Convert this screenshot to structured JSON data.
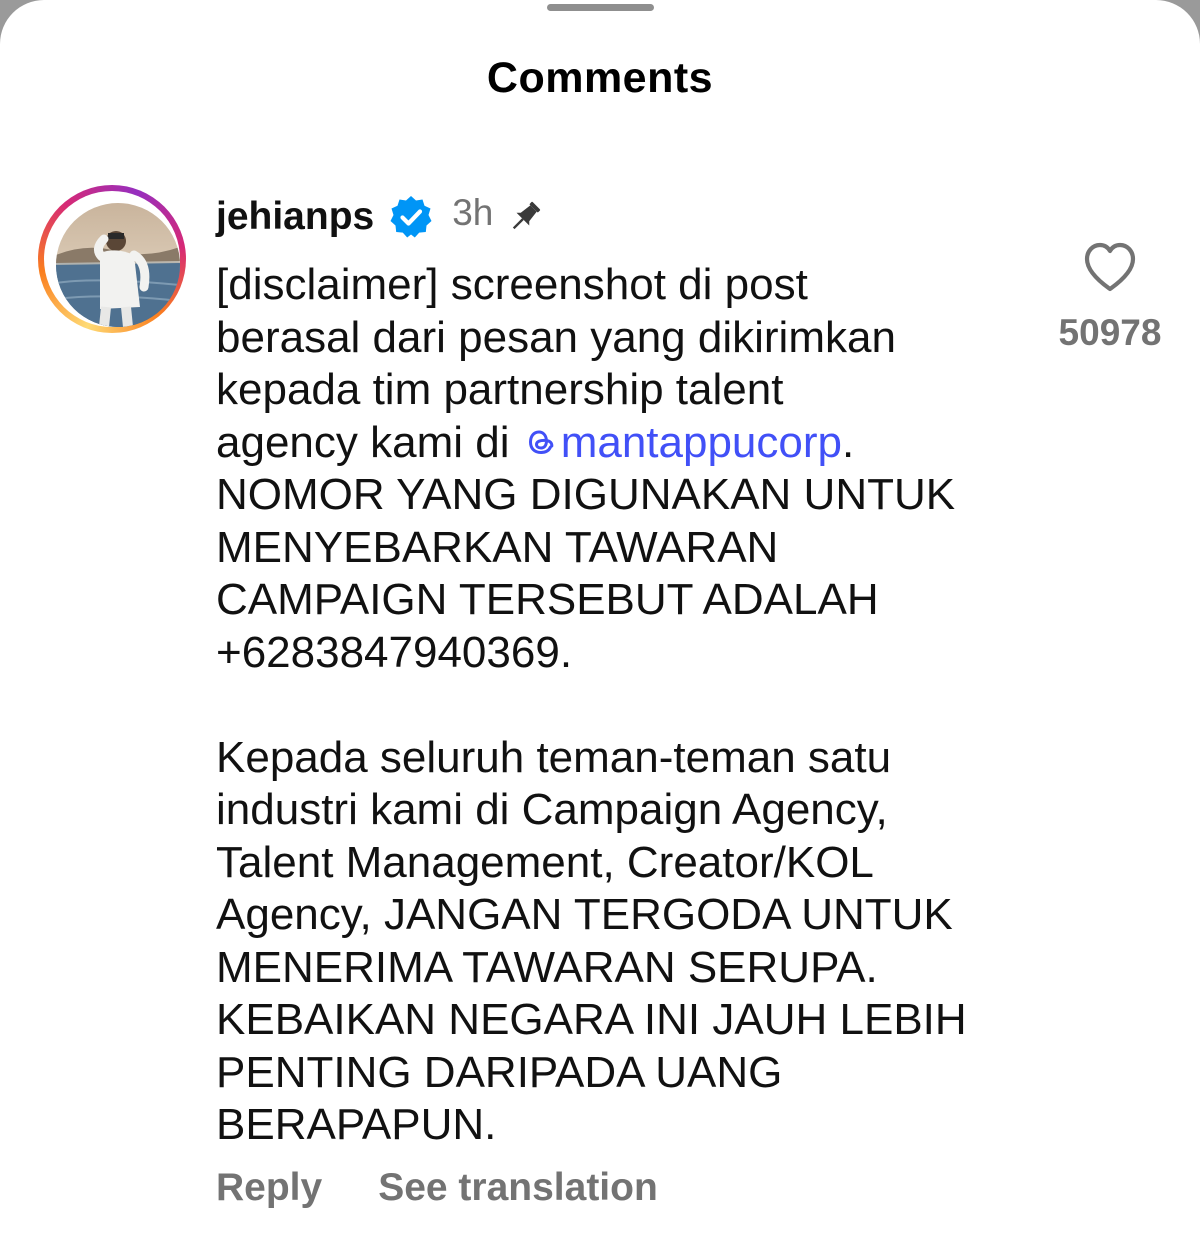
{
  "sheet": {
    "title": "Comments"
  },
  "comment": {
    "username": "jehianps",
    "verified": true,
    "time": "3h",
    "pinned": true,
    "text_before_mention": "[disclaimer] screenshot di post\nberasal dari pesan yang dikirimkan\nkepada tim partnership talent\nagency kami di ",
    "mention": "mantappucorp",
    "text_after_mention": ".\nNOMOR YANG DIGUNAKAN UNTUK\nMENYEBARKAN TAWARAN\nCAMPAIGN TERSEBUT ADALAH\n+6283847940369.\n\nKepada seluruh teman-teman satu\nindustri kami di Campaign Agency,\nTalent Management, Creator/KOL\nAgency, JANGAN TERGODA UNTUK\nMENERIMA TAWARAN SERUPA.\nKEBAIKAN NEGARA INI JAUH LEBIH\nPENTING DARIPADA UANG\nBERAPAPUN.",
    "like_count": "50978",
    "reply_label": "Reply",
    "translate_label": "See translation"
  },
  "icons": {
    "verified": "verified-badge-icon",
    "pin": "pin-icon",
    "mention_prefix": "threads-icon",
    "like": "heart-icon"
  },
  "colors": {
    "mention": "#4150f7",
    "verified_badge": "#0095f6",
    "secondary_text": "#737373"
  }
}
